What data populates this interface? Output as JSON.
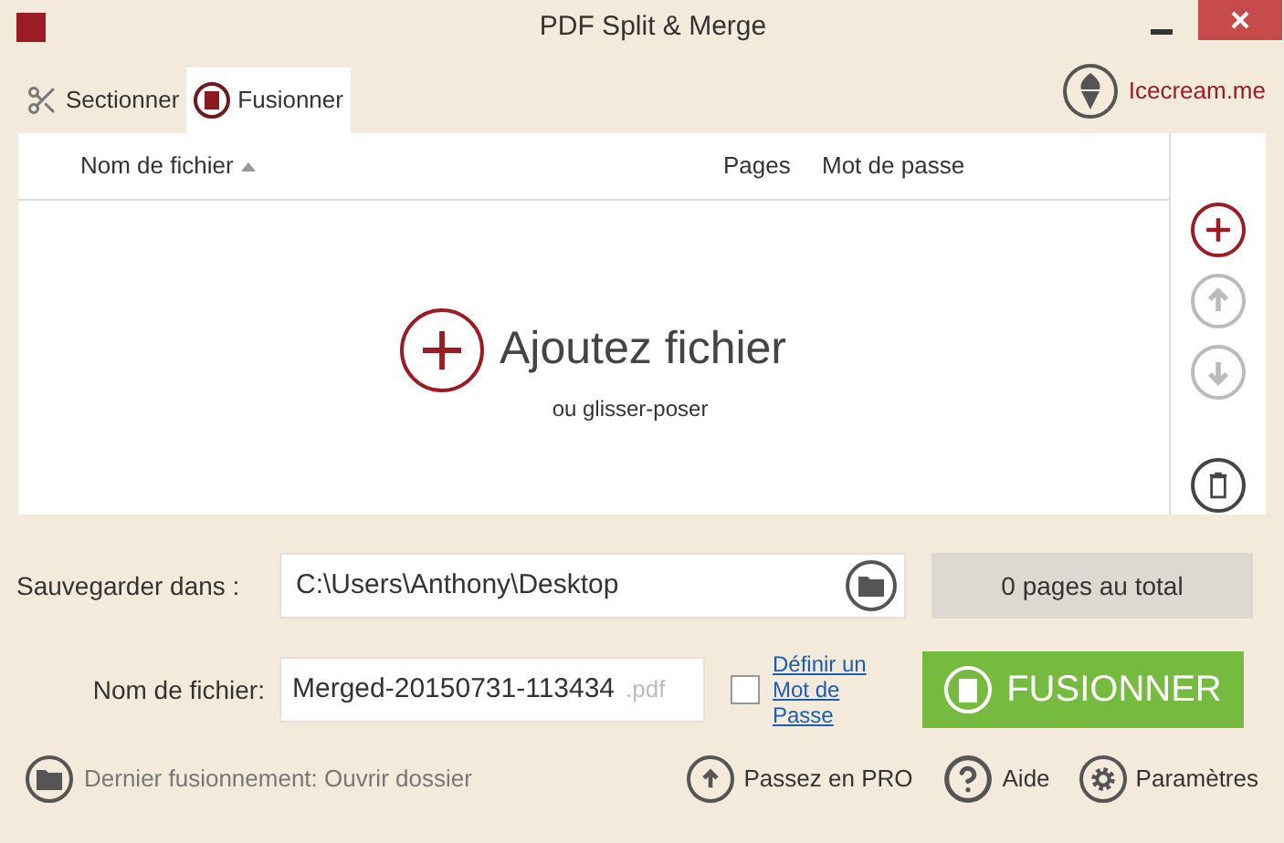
{
  "window": {
    "title": "PDF Split & Merge"
  },
  "tabs": [
    {
      "label": "Sectionner",
      "selected": false,
      "kind": "split"
    },
    {
      "label": "Fusionner",
      "selected": true,
      "kind": "merge"
    }
  ],
  "brand_link": "Icecream.me",
  "table": {
    "columns": [
      {
        "label": "Nom de fichier",
        "sorted": true
      },
      {
        "label": "Pages",
        "sorted": false
      },
      {
        "label": "Mot de passe",
        "sorted": false
      }
    ],
    "empty_title": "Ajoutez fichier",
    "empty_hint": "ou glisser-poser"
  },
  "side_buttons": [
    {
      "kind": "add",
      "disabled": false
    },
    {
      "kind": "up",
      "disabled": true
    },
    {
      "kind": "down",
      "disabled": true
    },
    {
      "kind": "delete",
      "disabled": false
    }
  ],
  "save_label": "Sauvegarder dans :",
  "save_path": "C:\\Users\\Anthony\\Desktop",
  "total": "0 pages au total",
  "filename_label": "Nom de fichier:",
  "filename_value": "Merged-20150731-113434",
  "filename_ext": ".pdf",
  "password": {
    "checked": false,
    "link": "Définir un Mot de Passe"
  },
  "merge_button": "FUSIONNER",
  "last_merge": "Dernier fusionnement: Ouvrir dossier",
  "footer_links": [
    {
      "label": "Passez en PRO",
      "kind": "upgrade"
    },
    {
      "label": "Aide",
      "kind": "help"
    },
    {
      "label": "Paramètres",
      "kind": "settings"
    }
  ]
}
